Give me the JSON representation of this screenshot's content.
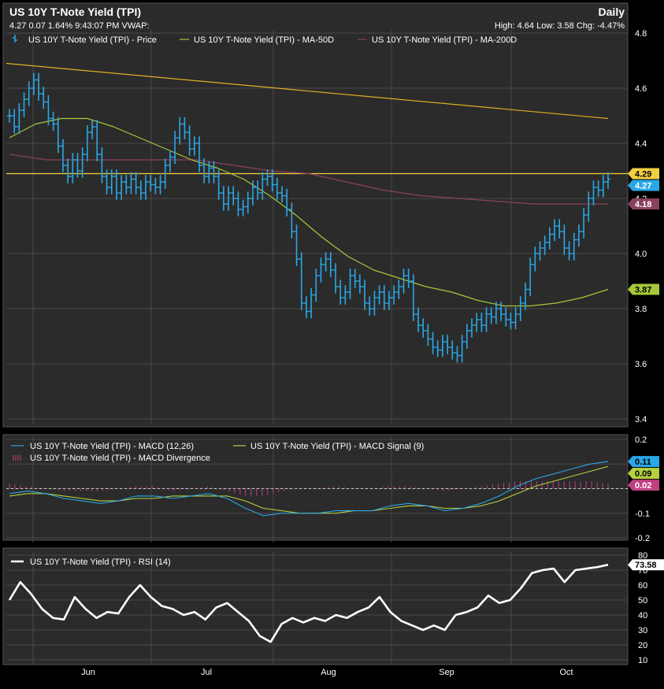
{
  "header": {
    "title": "US 10Y T-Note Yield (TPI)",
    "period": "Daily",
    "quote_line": "4.27 0.07 1.64% 9:43:07 PM VWAP:",
    "stats_line": "High: 4.64 Low: 3.58 Chg: -4.47%"
  },
  "colors": {
    "price": "#2aa7e6",
    "ma50": "#a5c93a",
    "ma200": "#8a4060",
    "trendline": "#e0b020",
    "hline": "#f0d040",
    "macd": "#2aa7e6",
    "signal": "#b5d040",
    "divergence": "#c04080",
    "rsi": "#ffffff",
    "background": "#2b2b2b",
    "grid": "#4a4a4a"
  },
  "chart_data": [
    {
      "type": "line",
      "title": "US 10Y T-Note Yield (TPI)",
      "legend": [
        "US 10Y T-Note Yield (TPI) - Price",
        "US 10Y T-Note Yield (TPI) - MA-50D",
        "US 10Y T-Note Yield (TPI) - MA-200D"
      ],
      "ylim": [
        3.4,
        4.8
      ],
      "yticks": [
        3.4,
        3.6,
        3.8,
        4.0,
        4.2,
        4.4,
        4.6,
        4.8
      ],
      "xticks": [
        "Jun",
        "Jul",
        "Aug",
        "Sep",
        "Oct"
      ],
      "grid": true,
      "series": [
        {
          "name": "US 10Y T-Note Yield (TPI) - Price",
          "style": "hlc-bars",
          "values": [
            4.5,
            4.46,
            4.52,
            4.56,
            4.6,
            4.63,
            4.58,
            4.55,
            4.49,
            4.47,
            4.39,
            4.32,
            4.28,
            4.34,
            4.3,
            4.36,
            4.44,
            4.46,
            4.36,
            4.28,
            4.24,
            4.28,
            4.22,
            4.26,
            4.24,
            4.27,
            4.24,
            4.22,
            4.26,
            4.25,
            4.24,
            4.26,
            4.32,
            4.35,
            4.42,
            4.47,
            4.44,
            4.38,
            4.4,
            4.32,
            4.28,
            4.31,
            4.28,
            4.22,
            4.18,
            4.22,
            4.2,
            4.16,
            4.17,
            4.2,
            4.24,
            4.22,
            4.27,
            4.28,
            4.25,
            4.22,
            4.21,
            4.16,
            4.08,
            3.98,
            3.82,
            3.79,
            3.85,
            3.92,
            3.96,
            3.98,
            3.94,
            3.88,
            3.84,
            3.86,
            3.92,
            3.9,
            3.88,
            3.82,
            3.8,
            3.84,
            3.86,
            3.82,
            3.84,
            3.86,
            3.88,
            3.92,
            3.9,
            3.78,
            3.74,
            3.72,
            3.69,
            3.66,
            3.65,
            3.68,
            3.66,
            3.64,
            3.63,
            3.68,
            3.72,
            3.74,
            3.76,
            3.74,
            3.78,
            3.77,
            3.8,
            3.78,
            3.76,
            3.75,
            3.78,
            3.82,
            3.87,
            3.96,
            4.0,
            4.02,
            4.04,
            4.07,
            4.1,
            4.08,
            4.02,
            4.0,
            4.05,
            4.08,
            4.14,
            4.2,
            4.24,
            4.23,
            4.26,
            4.27
          ]
        },
        {
          "name": "US 10Y T-Note Yield (TPI) - MA-50D",
          "values": [
            4.42,
            4.47,
            4.49,
            4.49,
            4.46,
            4.42,
            4.38,
            4.34,
            4.31,
            4.27,
            4.21,
            4.14,
            4.06,
            3.99,
            3.94,
            3.91,
            3.88,
            3.86,
            3.83,
            3.81,
            3.81,
            3.82,
            3.84,
            3.87
          ]
        },
        {
          "name": "US 10Y T-Note Yield (TPI) - MA-200D",
          "values": [
            4.36,
            4.34,
            4.34,
            4.34,
            4.34,
            4.34,
            4.32,
            4.3,
            4.29,
            4.26,
            4.23,
            4.21,
            4.2,
            4.19,
            4.18,
            4.18,
            4.18
          ]
        }
      ],
      "trendline": [
        4.69,
        4.49
      ],
      "hline": 4.29,
      "value_tags": [
        {
          "label": "4.29",
          "value": 4.29,
          "color": "#f0d040",
          "text_color": "#000000"
        },
        {
          "label": "4.27",
          "value": 4.27,
          "color": "#2aa7e6",
          "text_color": "#ffffff"
        },
        {
          "label": "4.18",
          "value": 4.18,
          "color": "#8a4060",
          "text_color": "#ffffff"
        },
        {
          "label": "3.87",
          "value": 3.87,
          "color": "#a5c93a",
          "text_color": "#000000"
        }
      ]
    },
    {
      "type": "line",
      "legend": [
        "US 10Y T-Note Yield (TPI) - MACD (12,26)",
        "US 10Y T-Note Yield (TPI) - MACD Signal (9)",
        "US 10Y T-Note Yield (TPI) - MACD Divergence"
      ],
      "ylim": [
        -0.2,
        0.2
      ],
      "yticks": [
        0.2,
        0.1,
        0.0,
        -0.1,
        -0.2
      ],
      "ytick_labels": [
        "0.2",
        "",
        "",
        "-0.1",
        "-0.2"
      ],
      "series": [
        {
          "name": "US 10Y T-Note Yield (TPI) - MACD (12,26)",
          "values": [
            -0.02,
            -0.01,
            -0.02,
            -0.04,
            -0.05,
            -0.06,
            -0.05,
            -0.03,
            -0.03,
            -0.04,
            -0.03,
            -0.02,
            -0.04,
            -0.08,
            -0.11,
            -0.1,
            -0.1,
            -0.1,
            -0.09,
            -0.09,
            -0.09,
            -0.07,
            -0.06,
            -0.07,
            -0.09,
            -0.08,
            -0.06,
            -0.03,
            0.01,
            0.04,
            0.06,
            0.08,
            0.1,
            0.11
          ]
        },
        {
          "name": "US 10Y T-Note Yield (TPI) - MACD Signal (9)",
          "values": [
            -0.03,
            -0.02,
            -0.02,
            -0.03,
            -0.04,
            -0.05,
            -0.05,
            -0.04,
            -0.04,
            -0.03,
            -0.03,
            -0.03,
            -0.03,
            -0.05,
            -0.08,
            -0.09,
            -0.1,
            -0.1,
            -0.1,
            -0.09,
            -0.09,
            -0.08,
            -0.07,
            -0.07,
            -0.08,
            -0.08,
            -0.07,
            -0.05,
            -0.02,
            0.01,
            0.03,
            0.05,
            0.07,
            0.09
          ]
        },
        {
          "name": "US 10Y T-Note Yield (TPI) - MACD Divergence",
          "style": "histogram",
          "values": [
            0.02,
            0.01,
            0.0,
            -0.01,
            -0.01,
            -0.01,
            0.0,
            0.01,
            0.01,
            -0.01,
            0.0,
            0.01,
            -0.01,
            -0.03,
            -0.03,
            -0.01,
            0.0,
            0.0,
            0.01,
            0.0,
            0.0,
            0.01,
            0.01,
            0.0,
            -0.01,
            0.0,
            0.01,
            0.02,
            0.03,
            0.03,
            0.03,
            0.03,
            0.03,
            0.02
          ]
        }
      ],
      "value_tags": [
        {
          "label": "0.11",
          "value": 0.11,
          "color": "#2aa7e6",
          "text_color": "#000000"
        },
        {
          "label": "0.09",
          "value": 0.09,
          "color": "#b5d040",
          "text_color": "#000000"
        },
        {
          "label": "0.02",
          "value": 0.02,
          "color": "#c04080",
          "text_color": "#ffffff"
        }
      ]
    },
    {
      "type": "line",
      "legend": [
        "US 10Y T-Note Yield (TPI) - RSI (14)"
      ],
      "ylim": [
        10,
        80
      ],
      "yticks": [
        10,
        20,
        30,
        40,
        50,
        60,
        70,
        80
      ],
      "series": [
        {
          "name": "US 10Y T-Note Yield (TPI) - RSI (14)",
          "values": [
            50,
            62,
            54,
            44,
            38,
            37,
            52,
            44,
            38,
            42,
            41,
            52,
            60,
            52,
            46,
            44,
            40,
            42,
            37,
            45,
            48,
            42,
            36,
            26,
            22,
            34,
            38,
            35,
            38,
            36,
            40,
            38,
            42,
            45,
            52,
            42,
            36,
            33,
            30,
            33,
            30,
            40,
            42,
            45,
            53,
            48,
            50,
            58,
            68,
            70,
            71,
            62,
            70,
            71,
            72,
            73.58
          ]
        }
      ],
      "value_tags": [
        {
          "label": "73.58",
          "value": 73.58,
          "color": "#ffffff",
          "text_color": "#000000"
        }
      ]
    }
  ]
}
